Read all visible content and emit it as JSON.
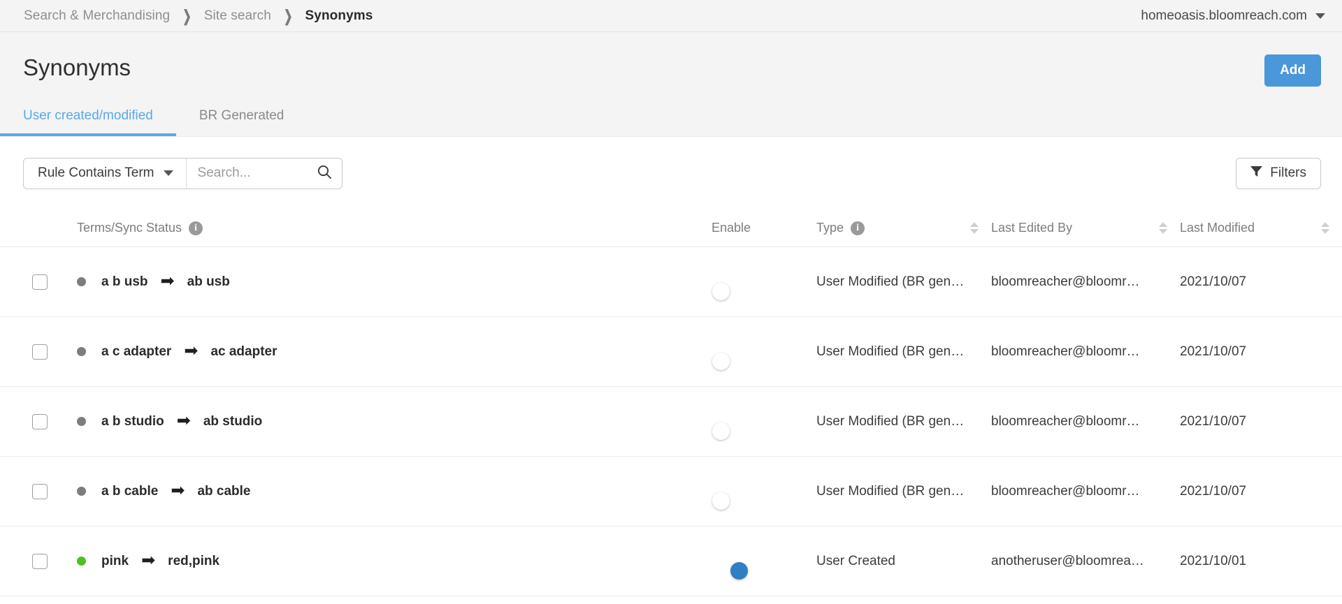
{
  "topbar": {
    "breadcrumb": [
      {
        "label": "Search & Merchandising",
        "current": false
      },
      {
        "label": "Site search",
        "current": false
      },
      {
        "label": "Synonyms",
        "current": true
      }
    ],
    "separator": "❯",
    "account": "homeoasis.bloomreach.com"
  },
  "pagehead": {
    "title": "Synonyms",
    "add_label": "Add",
    "tabs": [
      {
        "label": "User created/modified",
        "active": true
      },
      {
        "label": "BR Generated",
        "active": false
      }
    ]
  },
  "toolbar": {
    "rule_select": "Rule Contains Term",
    "search_placeholder": "Search...",
    "search_value": "",
    "filters_label": "Filters"
  },
  "table": {
    "columns": {
      "terms": "Terms/Sync Status",
      "enable": "Enable",
      "type": "Type",
      "last_edited_by": "Last Edited By",
      "last_modified": "Last Modified"
    },
    "rows": [
      {
        "checked": false,
        "status_color": "#7d7d7d",
        "source": "a b usb",
        "arrow": "➡",
        "target": "ab usb",
        "enabled": false,
        "type": "User Modified (BR gen…",
        "editor": "bloomreacher@bloomr…",
        "modified": "2021/10/07"
      },
      {
        "checked": false,
        "status_color": "#7d7d7d",
        "source": "a c adapter",
        "arrow": "➡",
        "target": "ac adapter",
        "enabled": false,
        "type": "User Modified (BR gen…",
        "editor": "bloomreacher@bloomr…",
        "modified": "2021/10/07"
      },
      {
        "checked": false,
        "status_color": "#7d7d7d",
        "source": "a b studio",
        "arrow": "➡",
        "target": "ab studio",
        "enabled": false,
        "type": "User Modified (BR gen…",
        "editor": "bloomreacher@bloomr…",
        "modified": "2021/10/07"
      },
      {
        "checked": false,
        "status_color": "#7d7d7d",
        "source": "a b cable",
        "arrow": "➡",
        "target": "ab cable",
        "enabled": false,
        "type": "User Modified (BR gen…",
        "editor": "bloomreacher@bloomr…",
        "modified": "2021/10/07"
      },
      {
        "checked": false,
        "status_color": "#4fc024",
        "source": "pink",
        "arrow": "➡",
        "target": "red,pink",
        "enabled": true,
        "type": "User Created",
        "editor": "anotheruser@bloomrea…",
        "modified": "2021/10/01"
      }
    ]
  },
  "colors": {
    "accent_blue": "#4a97da",
    "tab_active": "#58a9e8",
    "toggle_on": "#2e7fc4",
    "status_synced": "#4fc024",
    "status_pending": "#7d7d7d"
  },
  "icons": {
    "info": "i",
    "search": "search-icon",
    "filter": "filter-icon",
    "chevron": "chevron-down-icon"
  }
}
